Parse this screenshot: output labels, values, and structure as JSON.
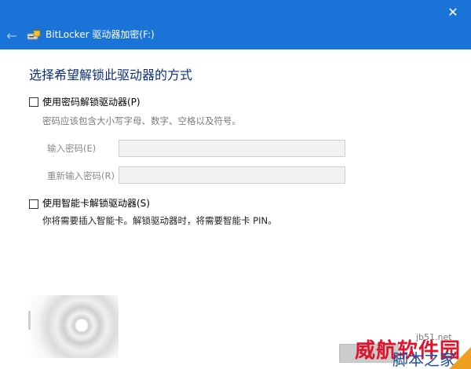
{
  "window": {
    "title": "BitLocker 驱动器加密(F:)",
    "close_glyph": "✕",
    "back_glyph": "←",
    "accent": "#1a74d8"
  },
  "heading": "选择希望解锁此驱动器的方式",
  "password_option": {
    "label": "使用密码解锁驱动器(P)",
    "checked": false,
    "hint": "密码应该包含大小写字母、数字、空格以及符号。",
    "enter_label": "输入密码(E)",
    "reenter_label": "重新输入密码(R)"
  },
  "smartcard_option": {
    "label": "使用智能卡解锁驱动器(S)",
    "checked": false,
    "description": "你将需要插入智能卡。解锁驱动器时，将需要智能卡 PIN。"
  },
  "footer": {
    "next_button": "下"
  },
  "watermark": {
    "red_text": "威航软件园",
    "blue_text": "脚本之家",
    "site": "jb51.net"
  }
}
